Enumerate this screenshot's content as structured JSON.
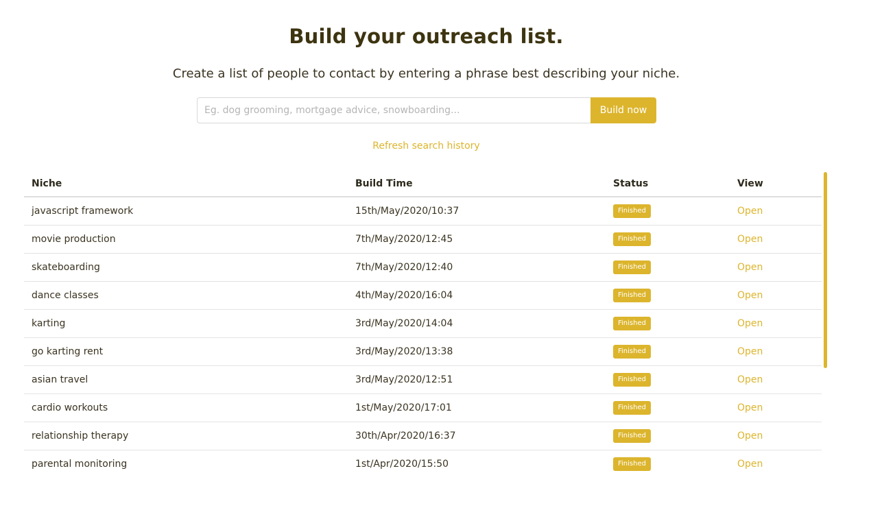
{
  "header": {
    "title": "Build your outreach list.",
    "subtitle": "Create a list of people to contact by entering a phrase best describing your niche."
  },
  "search": {
    "value": "",
    "placeholder": "Eg. dog grooming, mortgage advice, snowboarding...",
    "button_label": "Build now"
  },
  "refresh_label": "Refresh search history",
  "table": {
    "columns": [
      "Niche",
      "Build Time",
      "Status",
      "View"
    ],
    "rows": [
      {
        "niche": "javascript framework",
        "time": "15th/May/2020/10:37",
        "status": "Finished",
        "view": "Open"
      },
      {
        "niche": "movie production",
        "time": "7th/May/2020/12:45",
        "status": "Finished",
        "view": "Open"
      },
      {
        "niche": "skateboarding",
        "time": "7th/May/2020/12:40",
        "status": "Finished",
        "view": "Open"
      },
      {
        "niche": "dance classes",
        "time": "4th/May/2020/16:04",
        "status": "Finished",
        "view": "Open"
      },
      {
        "niche": "karting",
        "time": "3rd/May/2020/14:04",
        "status": "Finished",
        "view": "Open"
      },
      {
        "niche": "go karting rent",
        "time": "3rd/May/2020/13:38",
        "status": "Finished",
        "view": "Open"
      },
      {
        "niche": "asian travel",
        "time": "3rd/May/2020/12:51",
        "status": "Finished",
        "view": "Open"
      },
      {
        "niche": "cardio workouts",
        "time": "1st/May/2020/17:01",
        "status": "Finished",
        "view": "Open"
      },
      {
        "niche": "relationship therapy",
        "time": "30th/Apr/2020/16:37",
        "status": "Finished",
        "view": "Open"
      },
      {
        "niche": "parental monitoring",
        "time": "1st/Apr/2020/15:50",
        "status": "Finished",
        "view": "Open"
      }
    ]
  },
  "colors": {
    "accent": "#dcb52d",
    "title": "#3d3410"
  }
}
